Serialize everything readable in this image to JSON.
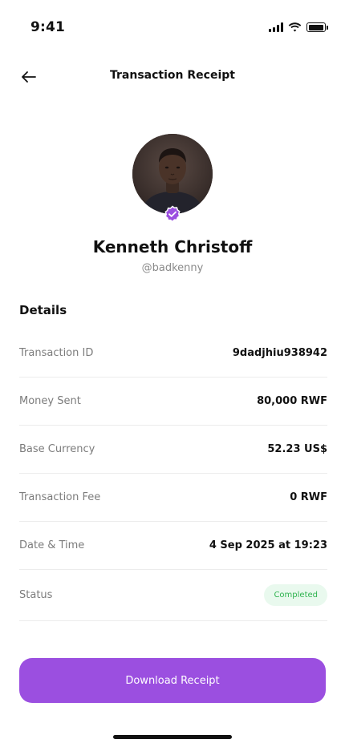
{
  "status_bar": {
    "time": "9:41",
    "icons": [
      "cellular-signal-icon",
      "wifi-icon",
      "battery-icon"
    ]
  },
  "header": {
    "title": "Transaction Receipt",
    "back_icon": "arrow-left-icon"
  },
  "profile": {
    "name": "Kenneth Christoff",
    "handle": "@badkenny",
    "verified": true,
    "badge_icon": "verified-check-icon"
  },
  "details": {
    "heading": "Details",
    "rows": [
      {
        "label": "Transaction ID",
        "value": "9dadjhiu938942"
      },
      {
        "label": "Money Sent",
        "value": "80,000 RWF"
      },
      {
        "label": "Base Currency",
        "value": "52.23 US$"
      },
      {
        "label": "Transaction Fee",
        "value": "0 RWF"
      },
      {
        "label": "Date & Time",
        "value": "4 Sep 2025 at 19:23"
      },
      {
        "label": "Status",
        "value": "Completed"
      }
    ]
  },
  "actions": {
    "download_label": "Download Receipt"
  },
  "colors": {
    "accent": "#9b4fe0",
    "status_success_text": "#2eb34f",
    "status_success_bg": "#e9f9ee"
  }
}
